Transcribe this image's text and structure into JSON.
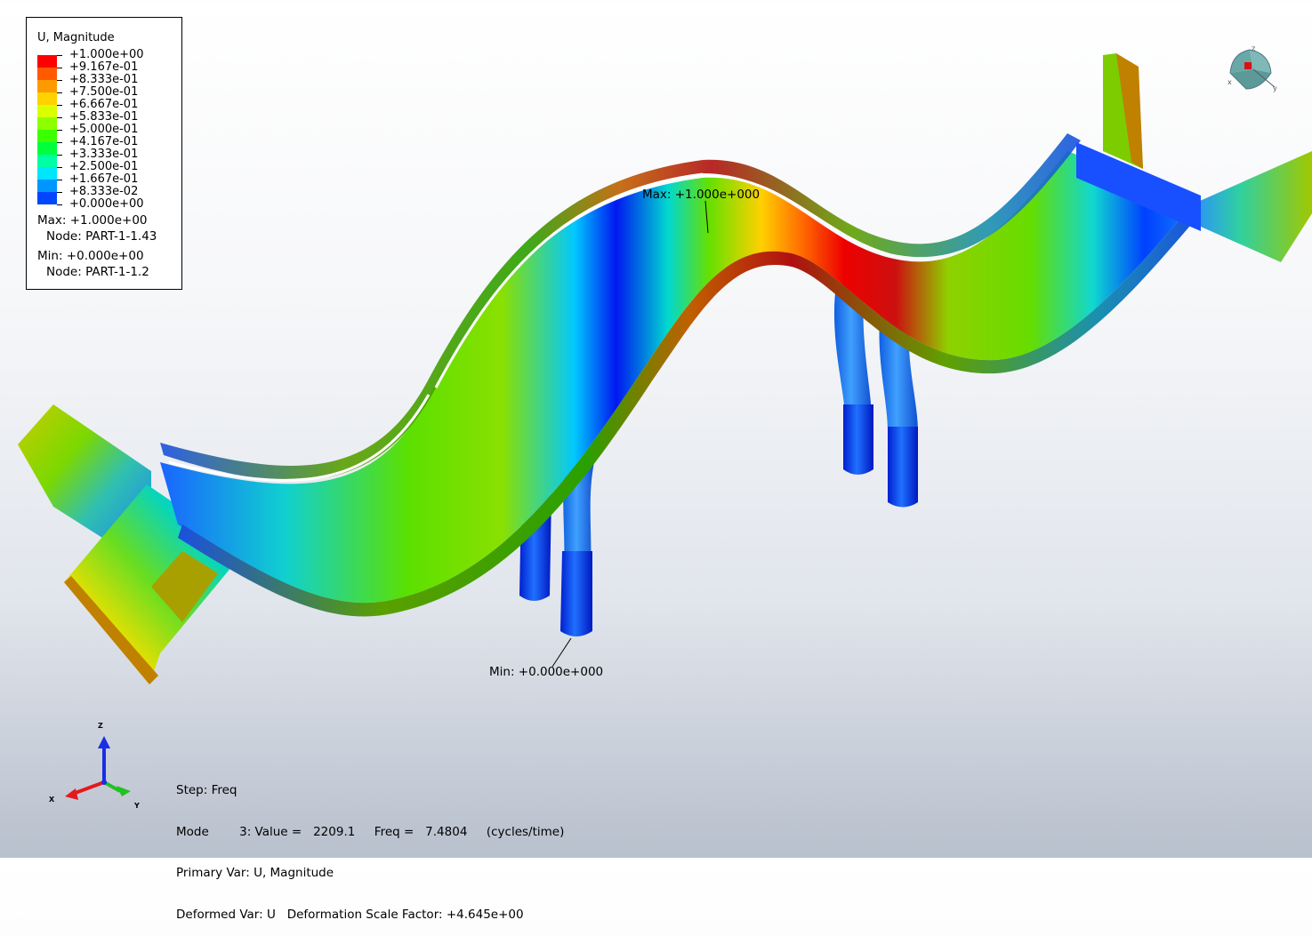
{
  "legend": {
    "title": "U, Magnitude",
    "entries": [
      {
        "label": "+1.000e+00",
        "color": "#ff0000"
      },
      {
        "label": "+9.167e-01",
        "color": "#ff5a00"
      },
      {
        "label": "+8.333e-01",
        "color": "#ff9900"
      },
      {
        "label": "+7.500e-01",
        "color": "#ffd200"
      },
      {
        "label": "+6.667e-01",
        "color": "#d9ff00"
      },
      {
        "label": "+5.833e-01",
        "color": "#8cff00"
      },
      {
        "label": "+5.000e-01",
        "color": "#3cff00"
      },
      {
        "label": "+4.167e-01",
        "color": "#00ff3c"
      },
      {
        "label": "+3.333e-01",
        "color": "#00ffa5"
      },
      {
        "label": "+2.500e-01",
        "color": "#00e6ff"
      },
      {
        "label": "+1.667e-01",
        "color": "#0096ff"
      },
      {
        "label": "+8.333e-02",
        "color": "#0046ff"
      },
      {
        "label": "+0.000e+00",
        "color": "#0000ff"
      }
    ],
    "max_line": "Max: +1.000e+00",
    "max_node": "Node: PART-1-1.43",
    "min_line": "Min: +0.000e+00",
    "min_node": "Node: PART-1-1.2"
  },
  "annotations": {
    "max": "Max: +1.000e+000",
    "min": "Min: +0.000e+000"
  },
  "info": {
    "step": "Step: Freq",
    "mode": "Mode        3: Value =   2209.1     Freq =   7.4804     (cycles/time)",
    "primary_var": "Primary Var: U, Magnitude",
    "deformed_var": "Deformed Var: U   Deformation Scale Factor: +4.645e+00"
  },
  "triad": {
    "x": "X",
    "y": "Y",
    "z": "Z"
  },
  "viewcube": {
    "x": "x",
    "y": "y",
    "z": "z"
  },
  "colors": {
    "background_top": "#ffffff",
    "background_bottom": "#b8c0cd",
    "axis_x": "#e41a1a",
    "axis_y": "#22c022",
    "axis_z": "#1a2ee4"
  }
}
